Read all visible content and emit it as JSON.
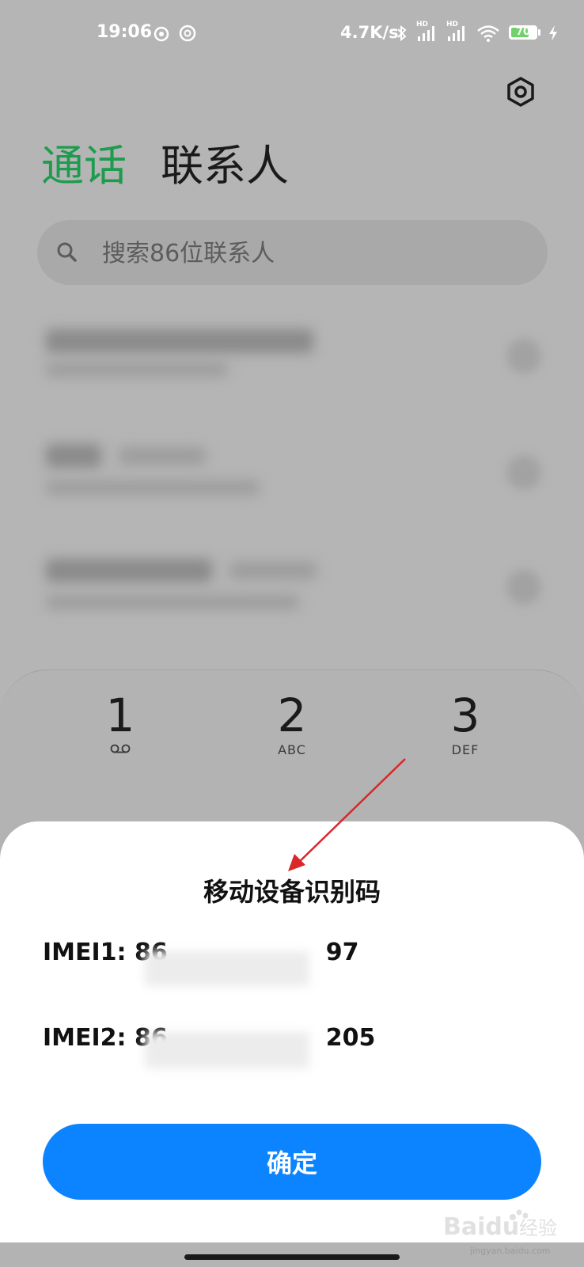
{
  "status_bar": {
    "time": "19:06",
    "network_speed": "4.7K/s",
    "signal1_label": "HD",
    "signal2_label": "HD",
    "battery_level": "70"
  },
  "header": {
    "tab_calls": "通话",
    "tab_contacts": "联系人"
  },
  "search": {
    "placeholder": "搜索86位联系人"
  },
  "dialpad": {
    "keys": [
      {
        "digit": "1",
        "sub": ""
      },
      {
        "digit": "2",
        "sub": "ABC"
      },
      {
        "digit": "3",
        "sub": "DEF"
      }
    ]
  },
  "dialog": {
    "title": "移动设备识别码",
    "imei1_prefix": "IMEI1: 86",
    "imei1_suffix": "97",
    "imei2_prefix": "IMEI2: 86",
    "imei2_suffix": "205",
    "confirm_label": "确定"
  },
  "colors": {
    "accent_green": "#1e9c4e",
    "button_blue": "#0d84ff",
    "annotation_red": "#d8282a"
  },
  "watermark": {
    "brand": "Baidu经验",
    "url": "jingyan.baidu.com"
  }
}
